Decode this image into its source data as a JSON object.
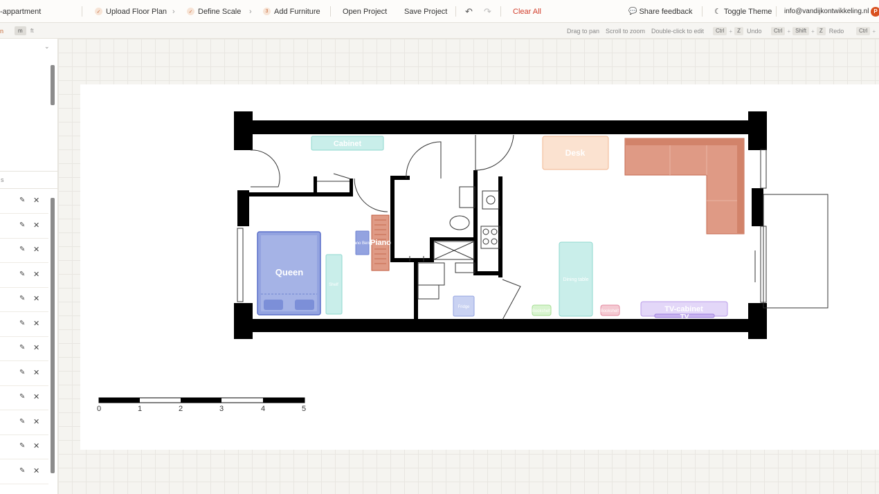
{
  "topbar": {
    "project_name": "-appartment",
    "steps": [
      {
        "label": "Upload Floor Plan",
        "marker": "✓"
      },
      {
        "label": "Define Scale",
        "marker": "✓"
      },
      {
        "label": "Add Furniture",
        "marker": "3"
      }
    ],
    "open_project": "Open Project",
    "save_project": "Save Project",
    "clear_all": "Clear All",
    "share_feedback": "Share feedback",
    "toggle_theme": "Toggle Theme",
    "email": "info@vandijkontwikkeling.nl",
    "avatar_initial": "P"
  },
  "subbar": {
    "units": {
      "left_fragment": "n",
      "m": "m",
      "ft": "ft",
      "active": "m"
    },
    "hints": [
      "Drag to pan",
      "Scroll to zoom",
      "Double-click to edit"
    ],
    "undo": {
      "keys": [
        "Ctrl",
        "Z"
      ],
      "label": "Undo"
    },
    "redo": {
      "keys": [
        "Ctrl",
        "Shift",
        "Z"
      ],
      "label": "Redo"
    },
    "trailing_key": "Ctrl"
  },
  "sidebar": {
    "header_fragment": "s",
    "row_count": 12
  },
  "floorplan": {
    "furniture": [
      "Cabinet",
      "Desk",
      "Sofa",
      "Queen",
      "Piano Bench",
      "Piano",
      "Shelf",
      "Fridge",
      "Dining table",
      "Bookshelf",
      "Bookshelf",
      "TV-cabinet",
      "TV"
    ],
    "scale_labels": [
      "0",
      "1",
      "2",
      "3",
      "4",
      "5"
    ]
  },
  "colors": {
    "accent": "#c76a3a",
    "clear_all": "#d23d2b",
    "queen_fill": "#93a3e0",
    "sofa_fill": "#df9a85",
    "desk_fill": "#fbe2d0",
    "teal_fill": "#c9eeea"
  }
}
